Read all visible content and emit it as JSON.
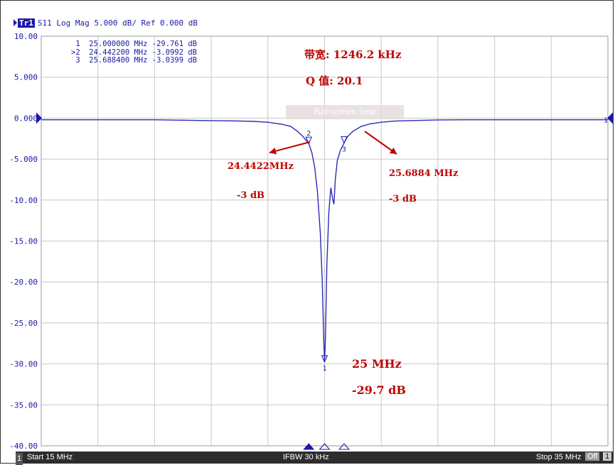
{
  "header": {
    "trace_badge": "Tr1",
    "trace_info": "S11 Log Mag 5.000 dB/ Ref 0.000 dB"
  },
  "marker_table": [
    {
      "id": "1",
      "freq": "25.000000 MHz",
      "value": "-29.761 dB"
    },
    {
      "id": ">2",
      "freq": "24.442200 MHz",
      "value": "-3.0992 dB"
    },
    {
      "id": "3",
      "freq": "25.688400 MHz",
      "value": "-3.0399 dB"
    }
  ],
  "annotations": {
    "bandwidth": "带宽: 1246.2 kHz",
    "q_value": "Q 值:  20.1",
    "left_freq": "24.4422MHz",
    "left_db": "-3 dB",
    "right_freq": "25.6884 MHz",
    "right_db": "-3 dB",
    "center_freq": "25 MHz",
    "center_db": "-29.7 dB"
  },
  "overlay": {
    "snip_label": "Full-screen Snip"
  },
  "footer": {
    "channel": "1",
    "start": "Start 15 MHz",
    "ifbw": "IFBW 30 kHz",
    "stop": "Stop 35 MHz",
    "off": "Off",
    "end_label": "1"
  },
  "colors": {
    "trace": "#2b2bb8",
    "annotation": "#c00000",
    "grid": "#c8c8c8"
  },
  "chart_data": {
    "type": "line",
    "title": "S11 Log Mag 5.000 dB/ Ref 0.000 dB",
    "xlabel": "",
    "ylabel": "",
    "xlim": [
      15,
      35
    ],
    "ylim": [
      -40,
      10
    ],
    "y_ticks": [
      "10.00",
      "5.000",
      "0.000",
      "-5.000",
      "-10.00",
      "-15.00",
      "-20.00",
      "-25.00",
      "-30.00",
      "-35.00",
      "-40.00"
    ],
    "y_tick_values": [
      10,
      5,
      0,
      -5,
      -10,
      -15,
      -20,
      -25,
      -30,
      -35,
      -40
    ],
    "grid": true,
    "series": [
      {
        "x": [
          15,
          17,
          19,
          20,
          21,
          22,
          22.5,
          23,
          23.5,
          23.8,
          24.0,
          24.2,
          24.3,
          24.4422,
          24.55,
          24.65,
          24.75,
          24.85,
          24.92,
          24.97,
          25.0,
          25.03,
          25.08,
          25.15,
          25.22,
          25.28,
          25.33,
          25.38,
          25.45,
          25.55,
          25.6884,
          25.8,
          26.0,
          26.3,
          26.6,
          27,
          27.5,
          28,
          29,
          30,
          31,
          33,
          35
        ],
        "values": [
          -0.2,
          -0.2,
          -0.2,
          -0.25,
          -0.3,
          -0.35,
          -0.4,
          -0.5,
          -0.75,
          -1.0,
          -1.5,
          -2.1,
          -2.5,
          -3.1,
          -4.2,
          -6.0,
          -9.0,
          -14.0,
          -20.0,
          -27.0,
          -29.76,
          -27.0,
          -18.0,
          -11.5,
          -8.5,
          -9.8,
          -10.5,
          -7.5,
          -5.2,
          -4.0,
          -3.04,
          -2.3,
          -1.6,
          -1.0,
          -0.7,
          -0.5,
          -0.35,
          -0.3,
          -0.22,
          -0.2,
          -0.2,
          -0.2,
          -0.2
        ]
      }
    ],
    "markers": [
      {
        "id": "1",
        "x": 25.0,
        "y": -29.761
      },
      {
        "id": "2",
        "x": 24.4422,
        "y": -3.0992
      },
      {
        "id": "3",
        "x": 25.6884,
        "y": -3.0399
      }
    ],
    "ref_level": 0
  }
}
